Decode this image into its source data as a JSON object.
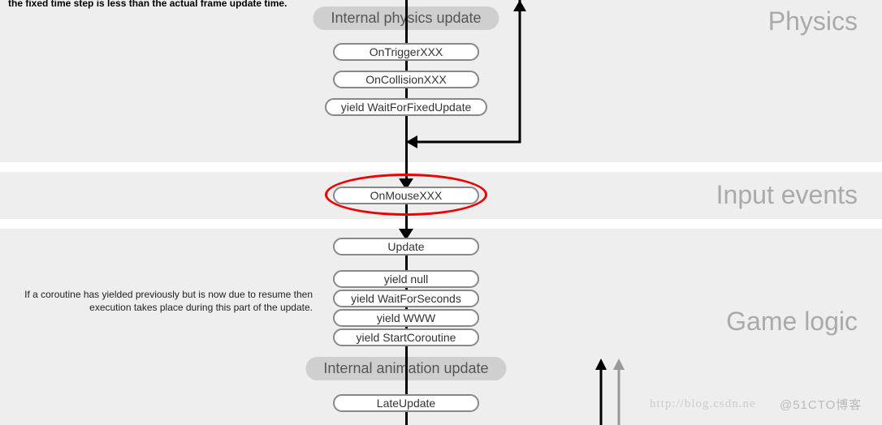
{
  "truncated_top": "the fixed time step is less than the actual frame update time.",
  "sections": {
    "physics": "Physics",
    "input": "Input events",
    "game": "Game logic"
  },
  "phases": {
    "phys_update": "Internal physics update",
    "anim_update": "Internal animation update"
  },
  "nodes": {
    "ontrigger": "OnTriggerXXX",
    "oncollision": "OnCollisionXXX",
    "waitfixed": "yield WaitForFixedUpdate",
    "onmouse": "OnMouseXXX",
    "update": "Update",
    "ynull": "yield null",
    "ywait": "yield WaitForSeconds",
    "ywww": "yield WWW",
    "ystart": "yield StartCoroutine",
    "late": "LateUpdate"
  },
  "note_coroutine": "If a coroutine has yielded previously but is now due to resume then execution takes place during this part of the update.",
  "watermark_left": "http://blog.csdn.ne",
  "watermark_right": "@51CTO博客"
}
